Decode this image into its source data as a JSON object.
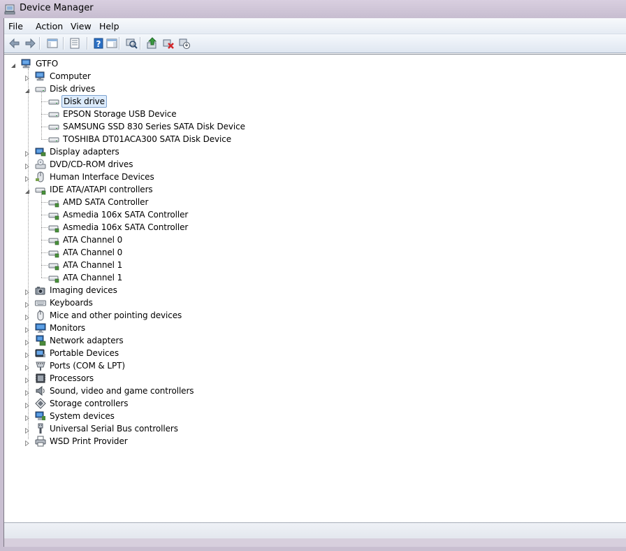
{
  "window": {
    "title": "Device Manager"
  },
  "menu": [
    "File",
    "Action",
    "View",
    "Help"
  ],
  "toolbar": [
    {
      "name": "back-icon"
    },
    {
      "name": "forward-icon"
    },
    {
      "sep": true
    },
    {
      "name": "show-hide-console-tree-icon"
    },
    {
      "sep": true
    },
    {
      "name": "properties-icon"
    },
    {
      "sep": true
    },
    {
      "name": "help-icon"
    },
    {
      "name": "action-pane-icon"
    },
    {
      "sep": true
    },
    {
      "name": "scan-hardware-icon"
    },
    {
      "sep": true
    },
    {
      "name": "update-driver-icon"
    },
    {
      "name": "uninstall-icon"
    },
    {
      "name": "disable-icon"
    }
  ],
  "tree": {
    "root": {
      "label": "GTFO",
      "icon": "computer-icon"
    },
    "nodes": [
      {
        "label": "Computer",
        "icon": "computer-icon",
        "expanded": false
      },
      {
        "label": "Disk drives",
        "icon": "disk-drive-icon",
        "expanded": true,
        "children": [
          {
            "label": "Disk drive",
            "icon": "disk-drive-icon",
            "selected": true
          },
          {
            "label": "EPSON Storage USB Device",
            "icon": "disk-drive-icon"
          },
          {
            "label": "SAMSUNG SSD 830 Series SATA Disk Device",
            "icon": "disk-drive-icon"
          },
          {
            "label": "TOSHIBA DT01ACA300 SATA Disk Device",
            "icon": "disk-drive-icon"
          }
        ]
      },
      {
        "label": "Display adapters",
        "icon": "display-adapter-icon",
        "expanded": false
      },
      {
        "label": "DVD/CD-ROM drives",
        "icon": "dvd-drive-icon",
        "expanded": false
      },
      {
        "label": "Human Interface Devices",
        "icon": "hid-icon",
        "expanded": false
      },
      {
        "label": "IDE ATA/ATAPI controllers",
        "icon": "ide-controller-icon",
        "expanded": true,
        "children": [
          {
            "label": "AMD SATA Controller",
            "icon": "ide-controller-icon"
          },
          {
            "label": "Asmedia 106x SATA Controller",
            "icon": "ide-controller-icon"
          },
          {
            "label": "Asmedia 106x SATA Controller",
            "icon": "ide-controller-icon"
          },
          {
            "label": "ATA Channel 0",
            "icon": "ide-controller-icon"
          },
          {
            "label": "ATA Channel 0",
            "icon": "ide-controller-icon"
          },
          {
            "label": "ATA Channel 1",
            "icon": "ide-controller-icon"
          },
          {
            "label": "ATA Channel 1",
            "icon": "ide-controller-icon"
          }
        ]
      },
      {
        "label": "Imaging devices",
        "icon": "camera-icon",
        "expanded": false
      },
      {
        "label": "Keyboards",
        "icon": "keyboard-icon",
        "expanded": false
      },
      {
        "label": "Mice and other pointing devices",
        "icon": "mouse-icon",
        "expanded": false
      },
      {
        "label": "Monitors",
        "icon": "monitor-icon",
        "expanded": false
      },
      {
        "label": "Network adapters",
        "icon": "network-adapter-icon",
        "expanded": false
      },
      {
        "label": "Portable Devices",
        "icon": "portable-device-icon",
        "expanded": false
      },
      {
        "label": "Ports (COM & LPT)",
        "icon": "port-icon",
        "expanded": false
      },
      {
        "label": "Processors",
        "icon": "processor-icon",
        "expanded": false
      },
      {
        "label": "Sound, video and game controllers",
        "icon": "speaker-icon",
        "expanded": false
      },
      {
        "label": "Storage controllers",
        "icon": "storage-controller-icon",
        "expanded": false
      },
      {
        "label": "System devices",
        "icon": "system-device-icon",
        "expanded": false
      },
      {
        "label": "Universal Serial Bus controllers",
        "icon": "usb-icon",
        "expanded": false
      },
      {
        "label": "WSD Print Provider",
        "icon": "printer-icon",
        "expanded": false
      }
    ]
  },
  "status_text": ""
}
